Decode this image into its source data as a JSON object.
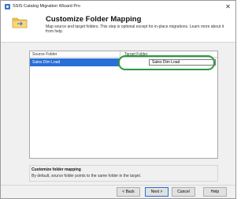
{
  "window": {
    "title": "SSIS Catalog Migration Wizard Pro",
    "close_glyph": "✕"
  },
  "header": {
    "title": "Customize Folder Mapping",
    "description": "Map source and target folders. This step is optional except for in-place migrations. Learn more about it from help.",
    "icon": "folder-mapping-icon"
  },
  "table": {
    "columns": [
      "Source Folder",
      "Target Folder"
    ],
    "rows": [
      {
        "source": "Sales Dim Load",
        "target": "Sales Dim Load",
        "selected": true
      }
    ]
  },
  "help_panel": {
    "title": "Customize folder mapping",
    "text": "By default, source folder points to the same folder in the target."
  },
  "buttons": {
    "back": "< Back",
    "next": "Next >",
    "cancel": "Cancel",
    "help": "Help"
  },
  "colors": {
    "selection": "#2a6fd6",
    "highlight_ring": "#2a9a3a"
  }
}
